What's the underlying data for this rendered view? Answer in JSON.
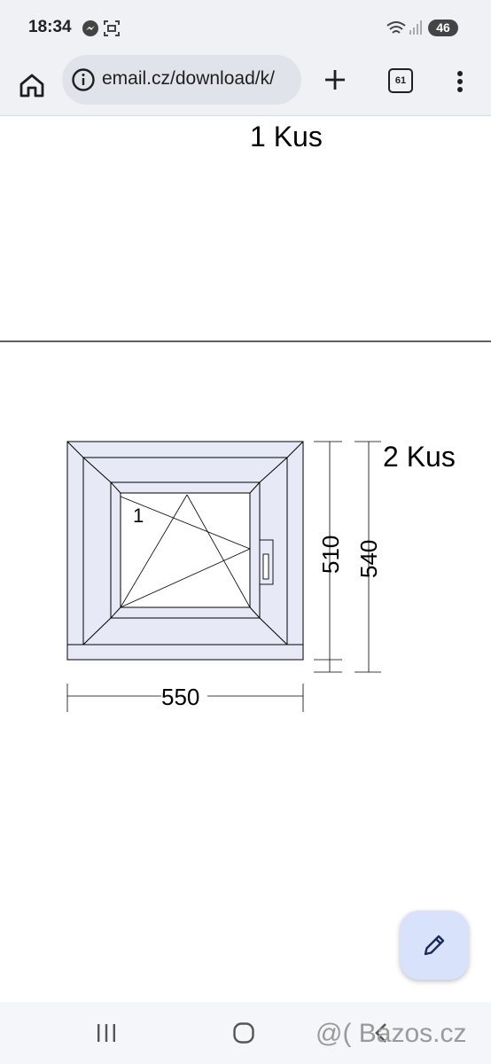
{
  "status_bar": {
    "time": "18:34",
    "icons": [
      "messenger-icon",
      "screenshot-icon",
      "wifi-icon",
      "signal-icon"
    ],
    "battery": "46"
  },
  "browser": {
    "url": "email.cz/download/k/",
    "tab_count": "61",
    "icons": [
      "home-icon",
      "info-icon",
      "plus-icon",
      "more-vert-icon"
    ]
  },
  "drawing": {
    "top_label": "1 Kus",
    "side_label": "2 Kus",
    "sash_number": "1",
    "width_dimension": "550",
    "inner_height_dimension": "510",
    "outer_height_dimension": "540",
    "stroke_color": "#000000",
    "fill_color": "#e8e9f7"
  },
  "fab": {
    "icon": "pencil-icon",
    "color": "#d8e2fb"
  },
  "nav": {
    "icons": [
      "recents-icon",
      "home-circle-icon",
      "back-icon"
    ]
  },
  "watermark": "@( Bazos.cz"
}
